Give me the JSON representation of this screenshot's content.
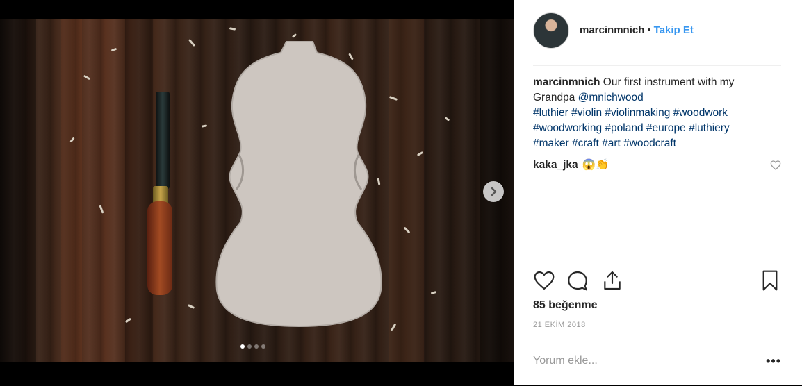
{
  "post": {
    "username": "marcinmnich",
    "separator": "•",
    "follow_label": "Takip Et",
    "caption_text": "Our first instrument with my Grandpa",
    "mention": "@mnichwood",
    "hashtags": [
      "#luthier",
      "#violin",
      "#violinmaking",
      "#woodwork",
      "#woodworking",
      "#poland",
      "#europe",
      "#luthiery",
      "#maker",
      "#craft",
      "#art",
      "#woodcraft"
    ],
    "comment": {
      "username": "kaka_jka",
      "emojis": "😱👏"
    },
    "likes": "85 beğenme",
    "date": "21 EKİM 2018",
    "comment_placeholder": "Yorum ekle...",
    "more_label": "•••"
  },
  "media": {
    "slides": 4,
    "active_slide": 1
  },
  "colors": {
    "follow": "#3897f0",
    "link": "#003569"
  },
  "icons": [
    "heart-icon",
    "comment-icon",
    "share-icon",
    "bookmark-icon",
    "chevron-right-icon"
  ]
}
